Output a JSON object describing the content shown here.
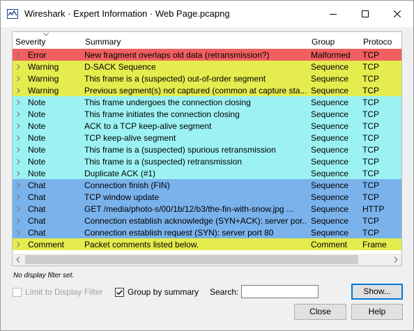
{
  "window": {
    "title": "Wireshark · Expert Information · Web Page.pcapng",
    "controls": [
      "minimize-icon",
      "maximize-icon",
      "close-icon"
    ]
  },
  "table": {
    "headers": {
      "severity": "Severity",
      "summary": "Summary",
      "group": "Group",
      "protocol": "Protoco"
    },
    "rows": [
      {
        "severity": "Error",
        "summary": "New fragment overlaps old data (retransmission?)",
        "group": "Malformed",
        "protocol": "TCP",
        "color": "#f06060",
        "text_color": "#000000"
      },
      {
        "severity": "Warning",
        "summary": "D-SACK Sequence",
        "group": "Sequence",
        "protocol": "TCP",
        "color": "#e4ec4e",
        "text_color": "#000000"
      },
      {
        "severity": "Warning",
        "summary": "This frame is a (suspected) out-of-order segment",
        "group": "Sequence",
        "protocol": "TCP",
        "color": "#e4ec4e",
        "text_color": "#000000"
      },
      {
        "severity": "Warning",
        "summary": "Previous segment(s) not captured (common at capture sta...",
        "group": "Sequence",
        "protocol": "TCP",
        "color": "#e4ec4e",
        "text_color": "#000000"
      },
      {
        "severity": "Note",
        "summary": "This frame undergoes the connection closing",
        "group": "Sequence",
        "protocol": "TCP",
        "color": "#9cf2f2",
        "text_color": "#000000"
      },
      {
        "severity": "Note",
        "summary": "This frame initiates the connection closing",
        "group": "Sequence",
        "protocol": "TCP",
        "color": "#9cf2f2",
        "text_color": "#000000"
      },
      {
        "severity": "Note",
        "summary": "ACK to a TCP keep-alive segment",
        "group": "Sequence",
        "protocol": "TCP",
        "color": "#9cf2f2",
        "text_color": "#000000"
      },
      {
        "severity": "Note",
        "summary": "TCP keep-alive segment",
        "group": "Sequence",
        "protocol": "TCP",
        "color": "#9cf2f2",
        "text_color": "#000000"
      },
      {
        "severity": "Note",
        "summary": "This frame is a (suspected) spurious retransmission",
        "group": "Sequence",
        "protocol": "TCP",
        "color": "#9cf2f2",
        "text_color": "#000000"
      },
      {
        "severity": "Note",
        "summary": "This frame is a (suspected) retransmission",
        "group": "Sequence",
        "protocol": "TCP",
        "color": "#9cf2f2",
        "text_color": "#000000"
      },
      {
        "severity": "Note",
        "summary": "Duplicate ACK (#1)",
        "group": "Sequence",
        "protocol": "TCP",
        "color": "#9cf2f2",
        "text_color": "#000000"
      },
      {
        "severity": "Chat",
        "summary": "Connection finish (FIN)",
        "group": "Sequence",
        "protocol": "TCP",
        "color": "#7ab2ec",
        "text_color": "#000000"
      },
      {
        "severity": "Chat",
        "summary": "TCP window update",
        "group": "Sequence",
        "protocol": "TCP",
        "color": "#7ab2ec",
        "text_color": "#000000"
      },
      {
        "severity": "Chat",
        "summary": "GET /media/photo-s/00/1b/12/b3/the-fin-with-snow.jpg ...",
        "group": "Sequence",
        "protocol": "HTTP",
        "color": "#7ab2ec",
        "text_color": "#000000"
      },
      {
        "severity": "Chat",
        "summary": "Connection establish acknowledge (SYN+ACK): server por...",
        "group": "Sequence",
        "protocol": "TCP",
        "color": "#7ab2ec",
        "text_color": "#000000"
      },
      {
        "severity": "Chat",
        "summary": "Connection establish request (SYN): server port 80",
        "group": "Sequence",
        "protocol": "TCP",
        "color": "#7ab2ec",
        "text_color": "#000000"
      },
      {
        "severity": "Comment",
        "summary": "Packet comments listed below.",
        "group": "Comment",
        "protocol": "Frame",
        "color": "#e4ec4e",
        "text_color": "#000000"
      }
    ]
  },
  "filter_note": "No display filter set.",
  "options": {
    "limit_to_display_filter": {
      "label": "Limit to Display Filter",
      "checked": false,
      "enabled": false
    },
    "group_by_summary": {
      "label": "Group by summary",
      "checked": true,
      "enabled": true
    }
  },
  "search": {
    "label": "Search:",
    "value": ""
  },
  "buttons": {
    "show": "Show...",
    "close": "Close",
    "help": "Help"
  }
}
